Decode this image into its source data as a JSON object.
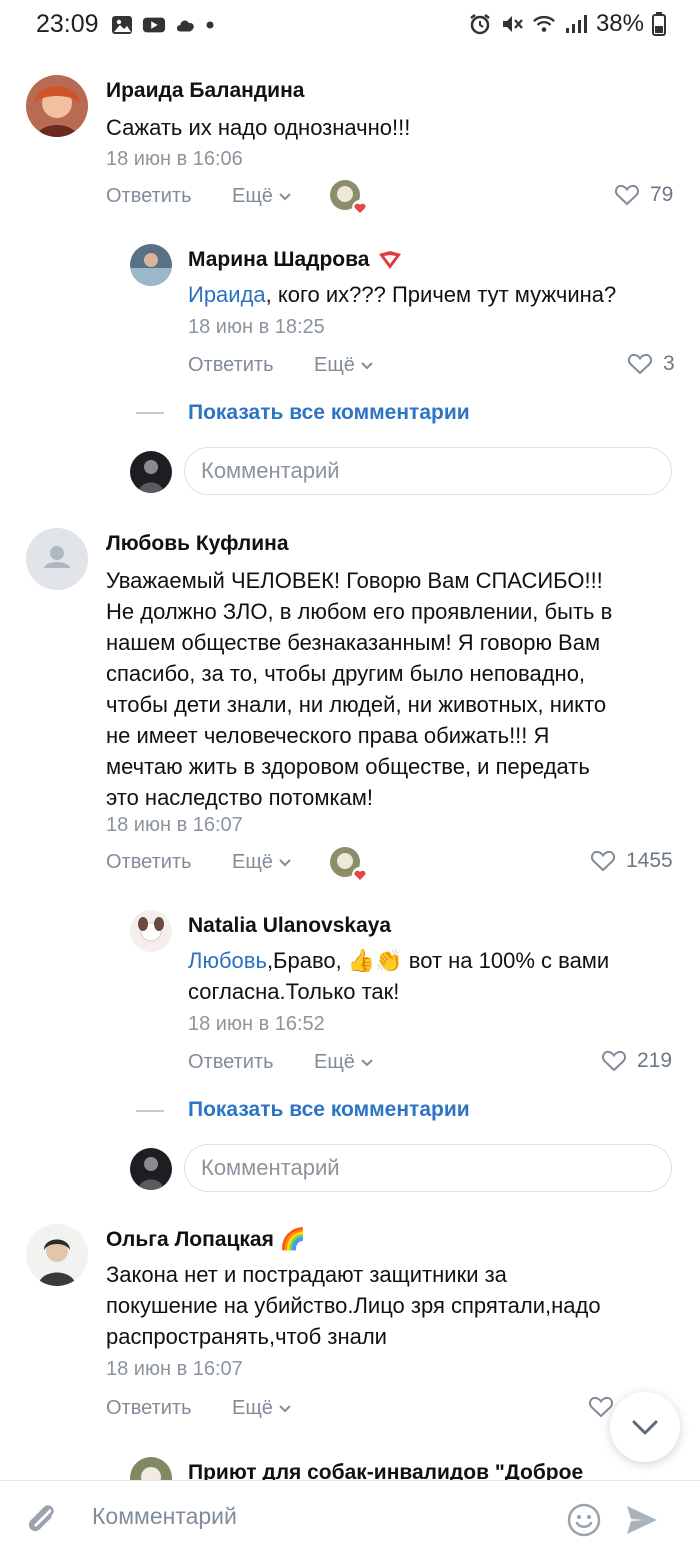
{
  "status_bar": {
    "time": "23:09",
    "battery": "38%"
  },
  "comments": [
    {
      "author": "Ираида Баландина",
      "text": "Сажать их надо однозначно!!!",
      "date": "18 июн в 16:06",
      "reply_label": "Ответить",
      "more_label": "Ещё",
      "likes": "79",
      "replies": [
        {
          "author": "Марина Шадрова",
          "mention": "Ираида",
          "text": ", кого их??? Причем тут мужчина?",
          "date": "18 июн в 18:25",
          "reply_label": "Ответить",
          "more_label": "Ещё",
          "likes": "3"
        }
      ],
      "show_all_label": "Показать все комментарии",
      "comment_placeholder": "Комментарий"
    },
    {
      "author": "Любовь Куфлина",
      "text_lines": [
        "Уважаемый ЧЕЛОВЕК! Говорю Вам СПАСИБО!!!",
        "Не должно ЗЛО, в любом его проявлении, быть в",
        "нашем обществе безнаказанным! Я говорю Вам",
        "спасибо, за то, чтобы другим было неповадно,",
        "чтобы дети знали, ни людей, ни животных, никто",
        "не имеет человеческого права обижать!!! Я",
        "мечтаю жить в здоровом обществе, и передать",
        "это наследство потомкам!"
      ],
      "date": "18 июн в 16:07",
      "reply_label": "Ответить",
      "more_label": "Ещё",
      "likes": "1455",
      "replies": [
        {
          "author": "Natalia Ulanovskaya",
          "mention": "Любовь",
          "text_line1": ",Браво, 👍👏 вот на 100% с вами",
          "text_line2": "согласна.Только так!",
          "date": "18 июн в 16:52",
          "reply_label": "Ответить",
          "more_label": "Ещё",
          "likes": "219"
        }
      ],
      "show_all_label": "Показать все комментарии",
      "comment_placeholder": "Комментарий"
    },
    {
      "author": "Ольга Лопацкая 🌈",
      "text_lines": [
        "Закона нет и пострадают защитники за",
        "покушение на убийство.Лицо зря спрятали,надо",
        "распространять,чтоб знали"
      ],
      "date": "18 июн в 16:07",
      "reply_label": "Ответить",
      "more_label": "Ещё"
    },
    {
      "author": "Приют для собак-инвалидов \"Доброе"
    }
  ],
  "bottom_bar": {
    "placeholder": "Комментарий"
  },
  "colors": {
    "link": "#2a72c0",
    "muted": "#818c99",
    "like_heart": "#e64646"
  }
}
